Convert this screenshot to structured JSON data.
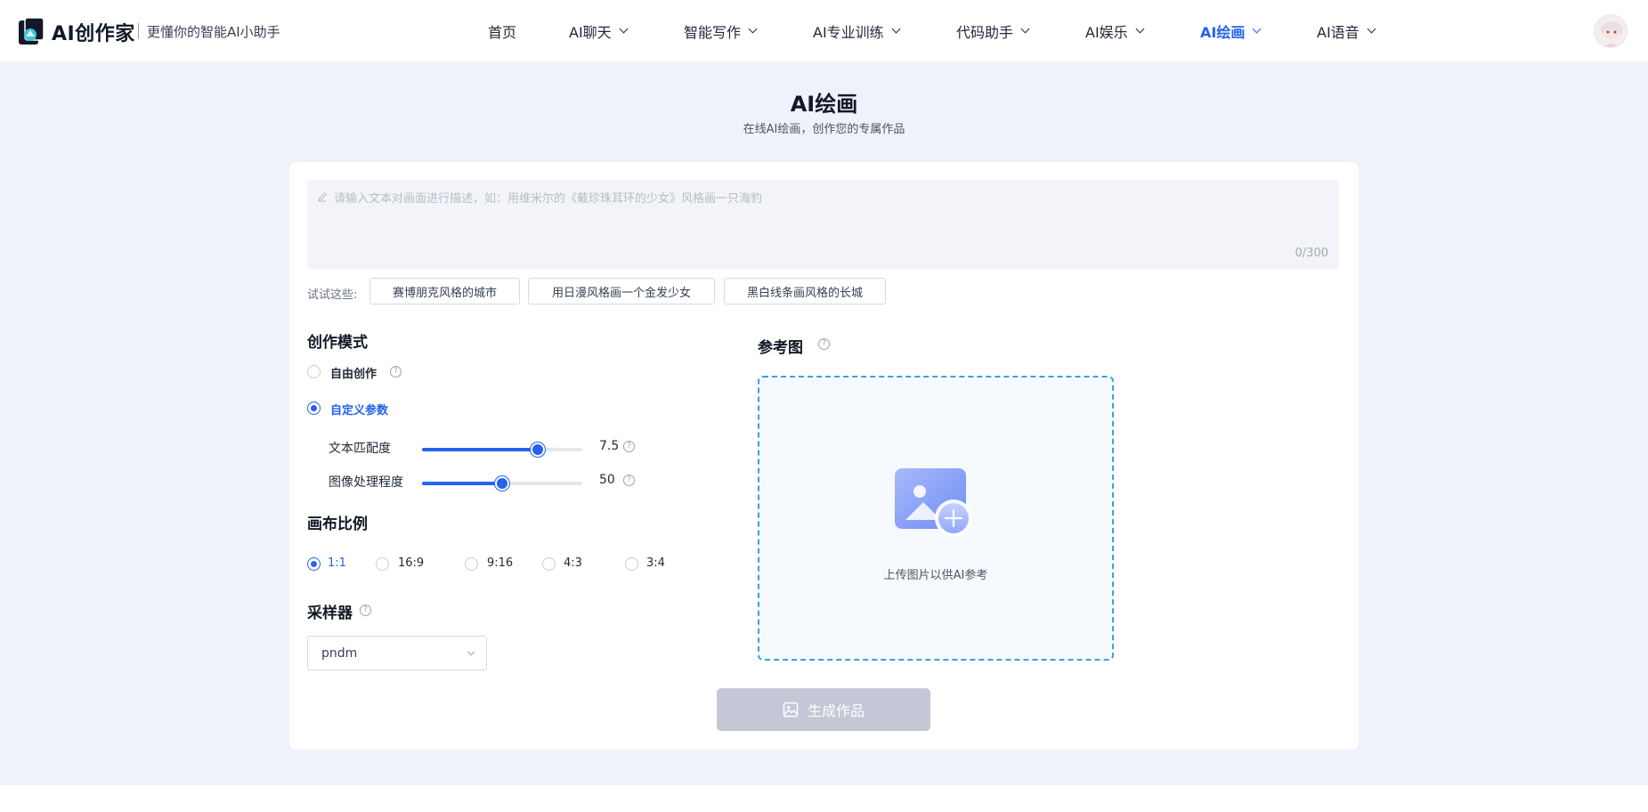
{
  "header": {
    "brand": "AI创作家",
    "slogan": "更懂你的智能AI小助手",
    "nav": [
      {
        "label": "首页",
        "dropdown": false
      },
      {
        "label": "AI聊天",
        "dropdown": true
      },
      {
        "label": "智能写作",
        "dropdown": true
      },
      {
        "label": "AI专业训练",
        "dropdown": true
      },
      {
        "label": "代码助手",
        "dropdown": true
      },
      {
        "label": "AI娱乐",
        "dropdown": true
      },
      {
        "label": "AI绘画",
        "dropdown": true,
        "active": true
      },
      {
        "label": "AI语音",
        "dropdown": true
      }
    ]
  },
  "page": {
    "title": "AI绘画",
    "subtitle": "在线AI绘画，创作您的专属作品"
  },
  "prompt": {
    "placeholder": "请输入文本对画面进行描述，如：用维米尔的《戴珍珠耳环的少女》风格画一只海豹",
    "value": "",
    "counter": "0/300"
  },
  "suggestions": {
    "label": "试试这些:",
    "items": [
      "赛博朋克风格的城市",
      "用日漫风格画一个金发少女",
      "黑白线条画风格的长城"
    ]
  },
  "mode": {
    "title": "创作模式",
    "options": [
      {
        "label": "自由创作",
        "checked": false
      },
      {
        "label": "自定义参数",
        "checked": true
      }
    ]
  },
  "sliders": [
    {
      "label": "文本匹配度",
      "value": "7.5",
      "fill": 0.72
    },
    {
      "label": "图像处理程度",
      "value": "50",
      "fill": 0.5
    }
  ],
  "ratio": {
    "title": "画布比例",
    "options": [
      {
        "label": "1:1",
        "checked": true
      },
      {
        "label": "16:9",
        "checked": false
      },
      {
        "label": "9:16",
        "checked": false
      },
      {
        "label": "4:3",
        "checked": false
      },
      {
        "label": "3:4",
        "checked": false
      }
    ]
  },
  "sampler": {
    "title": "采样器",
    "value": "pndm"
  },
  "reference": {
    "title": "参考图",
    "upload_text": "上传图片以供AI参考"
  },
  "generate": {
    "label": "生成作品"
  },
  "colors": {
    "accent": "#2563eb",
    "page_bg": "#eff2fb",
    "upload_border": "#38a3db",
    "button_disabled": "#c4c8d6"
  }
}
